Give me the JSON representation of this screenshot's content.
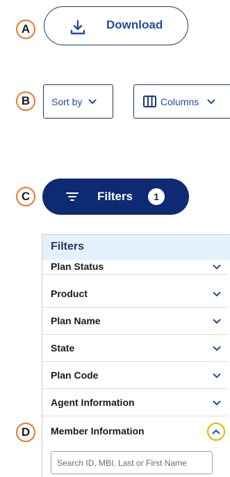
{
  "markers": {
    "a": "A",
    "b": "B",
    "c": "C",
    "d": "D"
  },
  "download": {
    "label": "Download",
    "icon": "download-icon"
  },
  "sort": {
    "label": "Sort by",
    "icon": "chevron-down-icon"
  },
  "columns": {
    "label": "Columns",
    "icon": "columns-icon"
  },
  "filters_button": {
    "label": "Filters",
    "badge": "1",
    "icon": "filter-lines-icon"
  },
  "panel": {
    "title": "Filters",
    "items": [
      {
        "label": "Plan Status",
        "expanded": false
      },
      {
        "label": "Product",
        "expanded": false
      },
      {
        "label": "Plan Name",
        "expanded": false
      },
      {
        "label": "State",
        "expanded": false
      },
      {
        "label": "Plan Code",
        "expanded": false
      },
      {
        "label": "Agent Information",
        "expanded": false
      },
      {
        "label": "Member Information",
        "expanded": true
      }
    ],
    "search_placeholder": "Search ID, MBI, Last or First Name"
  },
  "colors": {
    "accent": "#1f4e9c",
    "navy": "#0e2a73",
    "marker_border": "#e8772e",
    "highlight_ring": "#e8b400",
    "panel_header_bg": "#e6f2fb"
  }
}
